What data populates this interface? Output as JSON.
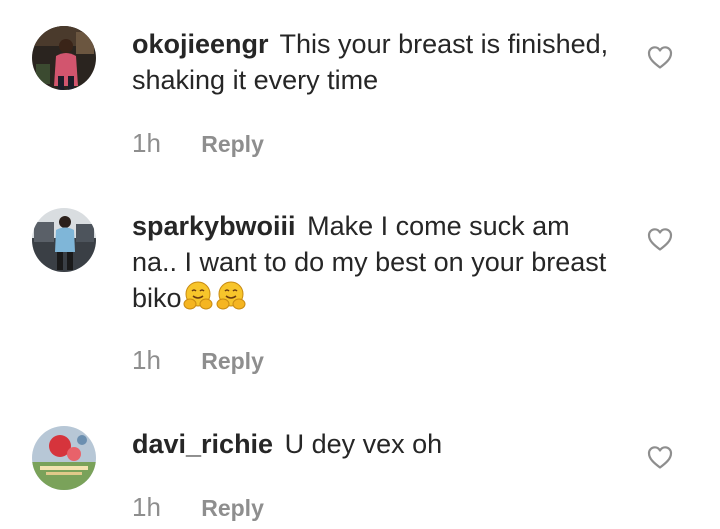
{
  "comments": [
    {
      "username": "okojieengr",
      "text": "This your breast is finished, shaking it every time",
      "time": "1h",
      "reply_label": "Reply",
      "emoji_count": 0
    },
    {
      "username": "sparkybwoiii",
      "text": "Make I come suck am na.. I want to do my best on your breast biko",
      "time": "1h",
      "reply_label": "Reply",
      "emoji": "🤗🤗"
    },
    {
      "username": "davi_richie",
      "text": "U dey vex oh",
      "time": "1h",
      "reply_label": "Reply"
    }
  ],
  "colors": {
    "text": "#262626",
    "muted": "#8e8e8e",
    "heart_stroke": "#8e8e8e"
  },
  "icons": {
    "like": "heart-outline-icon",
    "hug_emoji": "hugging-face-emoji"
  }
}
